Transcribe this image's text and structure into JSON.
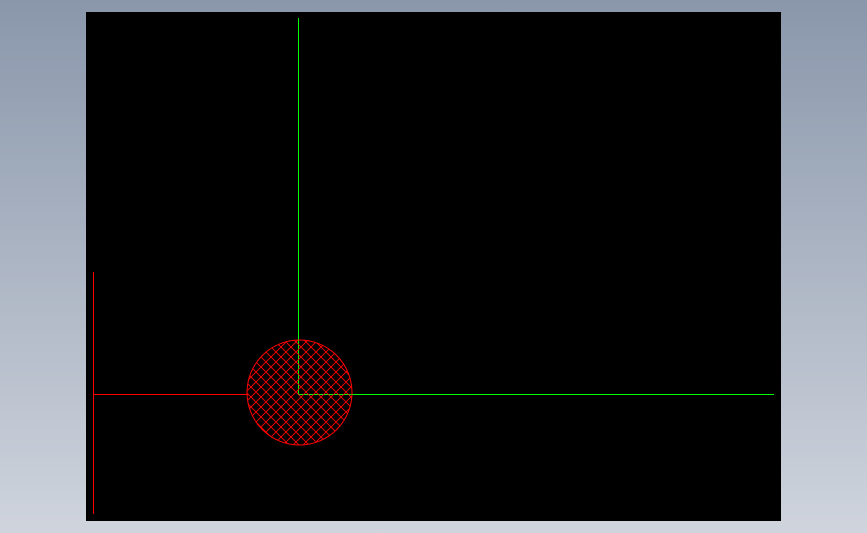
{
  "app": {
    "background_top_color": "#8a97ab",
    "background_bottom_color": "#cfd4dd"
  },
  "viewport": {
    "background_color": "#000000"
  },
  "drawing": {
    "axis_color": "#00ff00",
    "section_color": "#ff0000",
    "hatch_pattern": "cross-hatch",
    "elements": [
      "horizontal-axis-line",
      "vertical-axis-line",
      "section-reference-line",
      "section-leader-line",
      "hatched-circle-section"
    ]
  }
}
